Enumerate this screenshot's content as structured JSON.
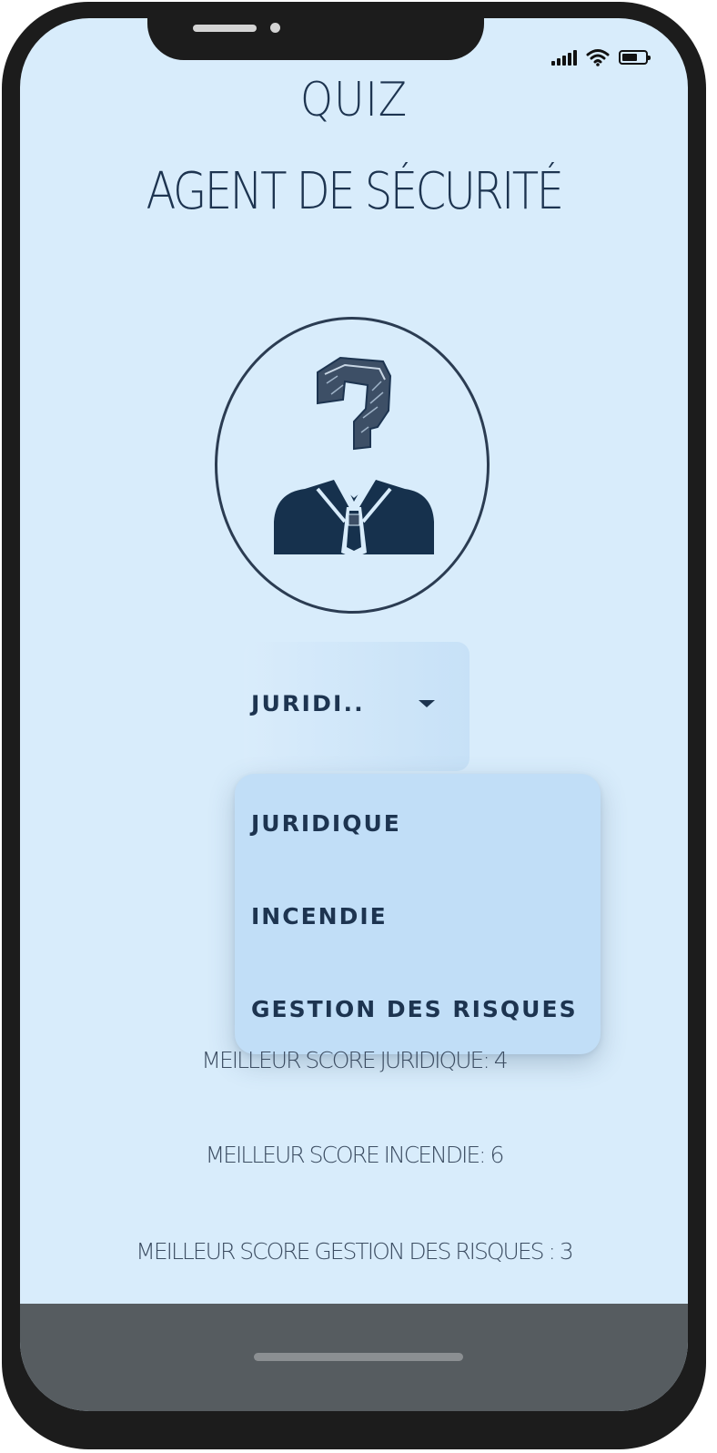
{
  "header": {
    "title_line1": "QUIZ",
    "title_line2": "AGENT DE SÉCURITÉ"
  },
  "avatar": {
    "icon": "security-agent-question-icon"
  },
  "category_select": {
    "selected_value": "JURIDI..",
    "options": [
      "JURIDIQUE",
      "INCENDIE",
      "GESTION DES RISQUES"
    ]
  },
  "scores": {
    "juridique": "MEILLEUR SCORE JURIDIQUE: 4",
    "incendie": "MEILLEUR SCORE INCENDIE: 6",
    "gestion": "MEILLEUR SCORE GESTION DES RISQUES : 3"
  },
  "status_bar": {
    "battery_level": 0.72
  },
  "colors": {
    "background": "#d8ecfb",
    "text": "#1d3450",
    "menu": "#c1def7",
    "nav_bar": "#565c60"
  }
}
